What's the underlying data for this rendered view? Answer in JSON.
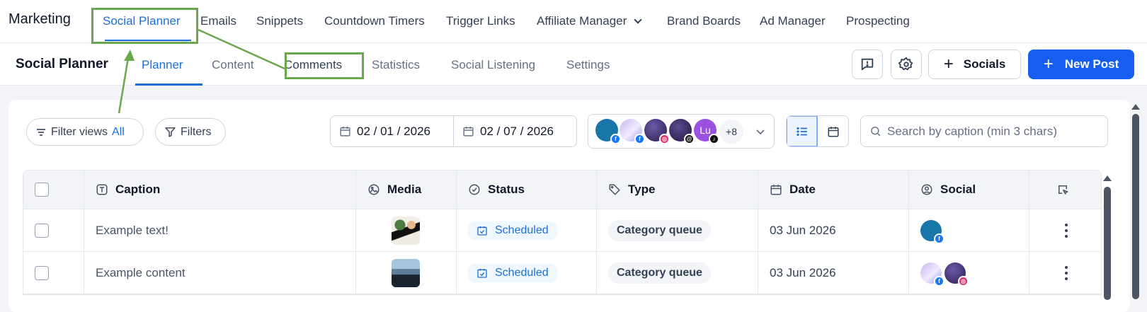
{
  "topnav": {
    "brand": "Marketing",
    "items": [
      "Social Planner",
      "Emails",
      "Snippets",
      "Countdown Timers",
      "Trigger Links",
      "Affiliate Manager",
      "Brand Boards",
      "Ad Manager",
      "Prospecting"
    ],
    "active": "Social Planner"
  },
  "subnav": {
    "title": "Social Planner",
    "tabs": [
      "Planner",
      "Content",
      "Comments",
      "Statistics",
      "Social Listening",
      "Settings"
    ],
    "active": "Planner",
    "socials_label": "Socials",
    "new_post_label": "New Post"
  },
  "toolbar": {
    "filter_views_label": "Filter views",
    "filter_views_value": "All",
    "filters_label": "Filters",
    "date_start": "02 / 01 / 2026",
    "date_end": "02 / 07 / 2026",
    "accounts_more": "+8",
    "avatar_initials": "Lu",
    "search_placeholder": "Search by caption (min 3 chars)"
  },
  "table": {
    "headers": [
      "Caption",
      "Media",
      "Status",
      "Type",
      "Date",
      "Social"
    ],
    "rows": [
      {
        "caption": "Example text!",
        "status": "Scheduled",
        "type": "Category queue",
        "date": "03 Jun 2026"
      },
      {
        "caption": "Example content",
        "status": "Scheduled",
        "type": "Category queue",
        "date": "03 Jun 2026"
      }
    ]
  },
  "colors": {
    "accent": "#155eef",
    "active_text": "#1d6fd8",
    "highlight": "#6aa84f",
    "facebook": "#1877f2",
    "instagram": "#e1306c"
  },
  "icons": [
    "filter-icon",
    "funnel-icon",
    "calendar-icon",
    "chevron-down-icon",
    "list-view-icon",
    "calendar-view-icon",
    "search-icon",
    "feedback-icon",
    "gear-icon",
    "plus-icon",
    "text-icon",
    "image-icon",
    "check-circle-icon",
    "tag-icon",
    "user-circle-icon",
    "edit-icon",
    "kebab-icon"
  ]
}
